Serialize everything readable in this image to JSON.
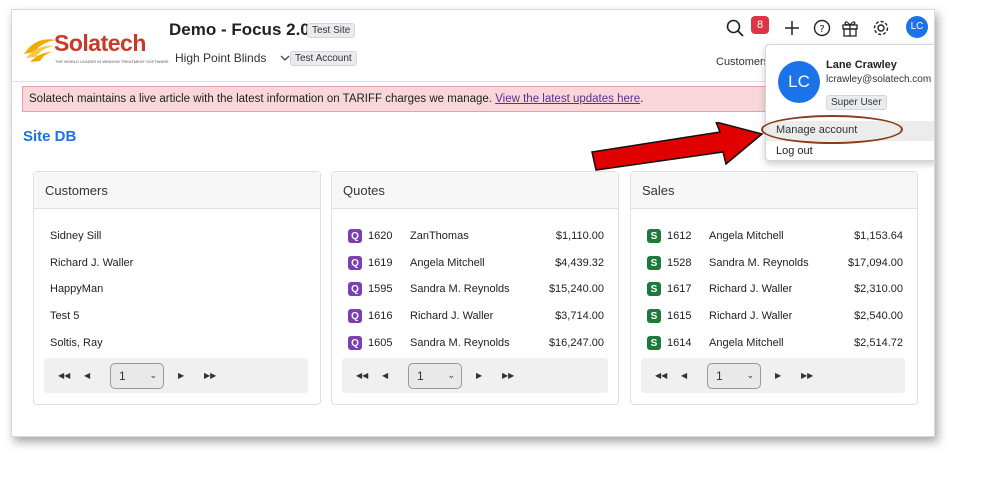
{
  "header": {
    "brand": "Solatech",
    "tagline": "THE WORLD LEADER IN WINDOW TREATMENT SOFTWARE",
    "site_title": "Demo - Focus 2.0",
    "site_badge": "Test Site",
    "company": "High Point Blinds",
    "account_badge": "Test Account",
    "notification_count": "8",
    "user_initials": "LC",
    "nav_customers": "Customers"
  },
  "alert": {
    "text": "Solatech maintains a live article with the latest information on TARIFF charges we manage. ",
    "link": "View the latest updates here",
    "suffix": "."
  },
  "page": {
    "title": "Site DB"
  },
  "customers": {
    "title": "Customers",
    "rows": [
      "Sidney Sill",
      "Richard J. Waller",
      "HappyMan",
      "Test 5",
      "Soltis, Ray"
    ],
    "page": "1"
  },
  "quotes": {
    "title": "Quotes",
    "icon_letter": "Q",
    "rows": [
      {
        "id": "1620",
        "name": "ZanThomas",
        "amount": "$1,110.00"
      },
      {
        "id": "1619",
        "name": "Angela Mitchell",
        "amount": "$4,439.32"
      },
      {
        "id": "1595",
        "name": "Sandra M. Reynolds",
        "amount": "$15,240.00"
      },
      {
        "id": "1616",
        "name": "Richard J. Waller",
        "amount": "$3,714.00"
      },
      {
        "id": "1605",
        "name": "Sandra M. Reynolds",
        "amount": "$16,247.00"
      }
    ],
    "page": "1"
  },
  "sales": {
    "title": "Sales",
    "icon_letter": "S",
    "rows": [
      {
        "id": "1612",
        "name": "Angela Mitchell",
        "amount": "$1,153.64"
      },
      {
        "id": "1528",
        "name": "Sandra M. Reynolds",
        "amount": "$17,094.00"
      },
      {
        "id": "1617",
        "name": "Richard J. Waller",
        "amount": "$2,310.00"
      },
      {
        "id": "1615",
        "name": "Richard J. Waller",
        "amount": "$2,540.00"
      },
      {
        "id": "1614",
        "name": "Angela Mitchell",
        "amount": "$2,514.72"
      }
    ],
    "page": "1"
  },
  "user_menu": {
    "initials": "LC",
    "name": "Lane Crawley",
    "email": "lcrawley@solatech.com",
    "role": "Super User",
    "manage": "Manage account",
    "logout": "Log out"
  },
  "icons": [
    "search-icon",
    "plus-icon",
    "help-icon",
    "gift-icon",
    "gear-icon"
  ],
  "colors": {
    "accent": "#1a73e8",
    "alert_bg": "#f8d7da",
    "quote_icon": "#7b3fb2",
    "sale_icon": "#1e7a3a",
    "badge_red": "#dc3545",
    "annotation_arrow": "#e00000"
  }
}
